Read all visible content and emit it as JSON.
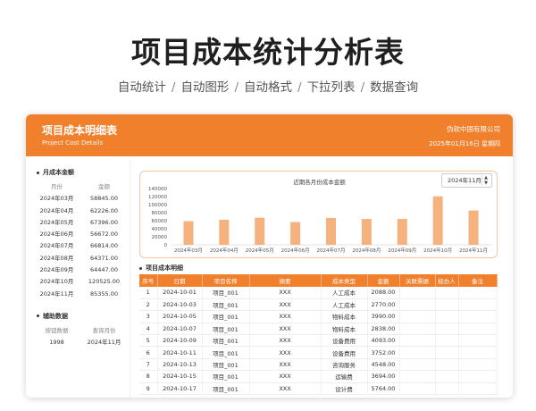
{
  "hero": {
    "title": "项目成本统计分析表",
    "features": [
      "自动统计",
      "自动图形",
      "自动格式",
      "下拉列表",
      "数据查询"
    ],
    "separator": "/"
  },
  "header": {
    "title": "项目成本明细表",
    "subtitle": "Project Cost Details",
    "company": "伪软中国有限公司",
    "date": "2025年01月16日 星期四"
  },
  "sidebar": {
    "monthly": {
      "title": "月成本金额",
      "columns": [
        "月份",
        "金额"
      ],
      "rows": [
        [
          "2024年03月",
          "58845.00"
        ],
        [
          "2024年04月",
          "62226.00"
        ],
        [
          "2024年05月",
          "67396.00"
        ],
        [
          "2024年06月",
          "56672.00"
        ],
        [
          "2024年07月",
          "66814.00"
        ],
        [
          "2024年08月",
          "64371.00"
        ],
        [
          "2024年09月",
          "64447.00"
        ],
        [
          "2024年10月",
          "120525.00"
        ],
        [
          "2024年11月",
          "85355.00"
        ]
      ]
    },
    "aux": {
      "title": "辅助数据",
      "columns": [
        "按钮数据",
        "查询月份"
      ],
      "row": [
        "1998",
        "2024年11月"
      ]
    }
  },
  "chart": {
    "selector_value": "2024年11月",
    "colors": {
      "bar": "#f5b27f",
      "axis_text": "#555555",
      "grid": "#eeeeee"
    }
  },
  "chart_data": {
    "type": "bar",
    "title": "近期各月份成本金额",
    "categories": [
      "2024年03月",
      "2024年04月",
      "2024年05月",
      "2024年06月",
      "2024年07月",
      "2024年08月",
      "2024年09月",
      "2024年10月",
      "2024年11月"
    ],
    "values": [
      58845,
      62226,
      67396,
      56672,
      66814,
      64371,
      64447,
      120525,
      85355
    ],
    "ylim": [
      0,
      140000
    ],
    "yticks": [
      "0",
      "20000",
      "40000",
      "60000",
      "80000",
      "100000",
      "120000",
      "140000"
    ],
    "xlabel": "",
    "ylabel": "",
    "grid": false
  },
  "detail": {
    "title": "项目成本明细",
    "columns": [
      "序号",
      "日期",
      "项目名称",
      "摘要",
      "成本类型",
      "金额",
      "关联票据",
      "经办人",
      "备注"
    ],
    "rows": [
      [
        "1",
        "2024-10-01",
        "项目_001",
        "XXX",
        "人工成本",
        "2088.00",
        "",
        "",
        ""
      ],
      [
        "2",
        "2024-10-03",
        "项目_001",
        "XXX",
        "人工成本",
        "2770.00",
        "",
        "",
        ""
      ],
      [
        "3",
        "2024-10-05",
        "项目_001",
        "XXX",
        "物料成本",
        "3990.00",
        "",
        "",
        ""
      ],
      [
        "4",
        "2024-10-07",
        "项目_001",
        "XXX",
        "物料成本",
        "2838.00",
        "",
        "",
        ""
      ],
      [
        "5",
        "2024-10-09",
        "项目_001",
        "XXX",
        "设备费用",
        "4093.00",
        "",
        "",
        ""
      ],
      [
        "6",
        "2024-10-11",
        "项目_001",
        "XXX",
        "设备费用",
        "3752.00",
        "",
        "",
        ""
      ],
      [
        "7",
        "2024-10-13",
        "项目_001",
        "XXX",
        "咨询服务",
        "4548.00",
        "",
        "",
        ""
      ],
      [
        "8",
        "2024-10-15",
        "项目_001",
        "XXX",
        "运输费",
        "3694.00",
        "",
        "",
        ""
      ],
      [
        "9",
        "2024-10-17",
        "项目_001",
        "XXX",
        "设计费",
        "5764.00",
        "",
        "",
        ""
      ]
    ]
  }
}
